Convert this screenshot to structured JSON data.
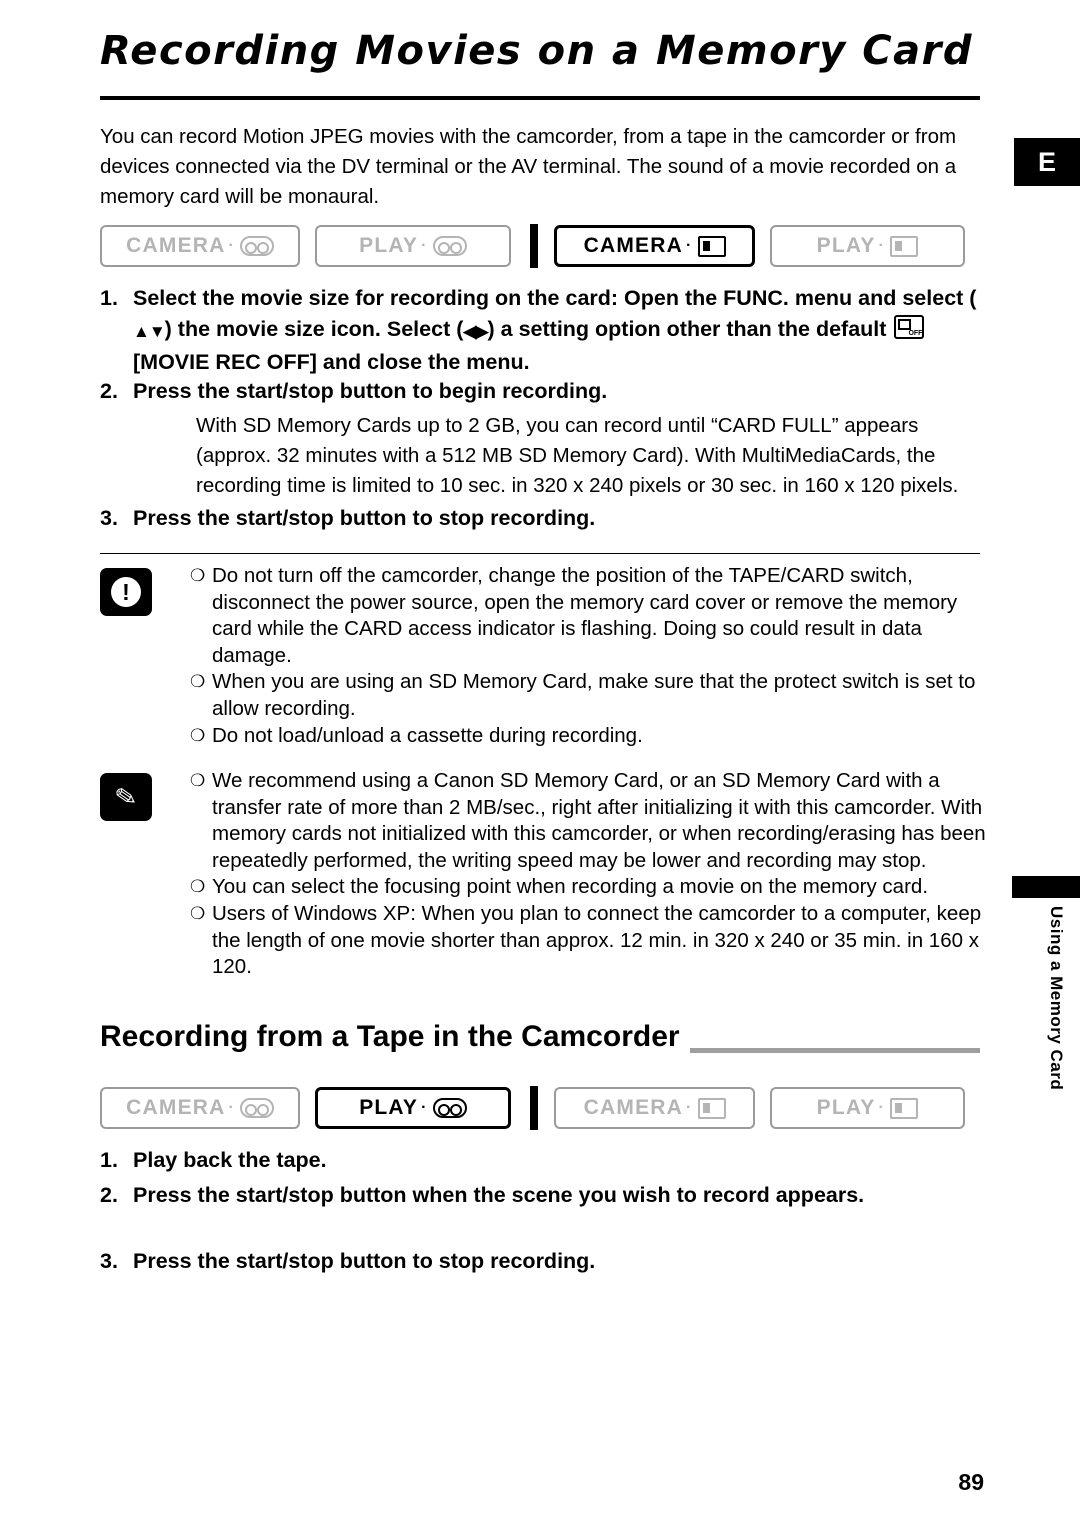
{
  "page": {
    "title": "Recording Movies on a Memory Card",
    "lang_tab": "E",
    "page_number": "89",
    "side_tab": "Using a Memory Card"
  },
  "intro": "You can record Motion JPEG movies with the camcorder, from a tape in the camcorder or from devices connected via the DV terminal or the AV terminal. The sound of a movie recorded on a memory card will be monaural.",
  "modes_row1": [
    {
      "label": "CAMERA",
      "icon": "tape-icon",
      "active": false
    },
    {
      "label": "PLAY",
      "icon": "tape-icon",
      "active": false
    },
    {
      "label": "CAMERA",
      "icon": "card-icon",
      "active": true
    },
    {
      "label": "PLAY",
      "icon": "card-icon",
      "active": false
    }
  ],
  "modes_row2": [
    {
      "label": "CAMERA",
      "icon": "tape-icon",
      "active": false
    },
    {
      "label": "PLAY",
      "icon": "tape-icon",
      "active": true
    },
    {
      "label": "CAMERA",
      "icon": "card-icon",
      "active": false
    },
    {
      "label": "PLAY",
      "icon": "card-icon",
      "active": false
    }
  ],
  "steps": {
    "s1_num": "1.",
    "s1_a": "Select the movie size for recording on the card: Open the FUNC. menu and select (",
    "s1_b": ") the movie size icon. Select (",
    "s1_c": ") a setting option other than the default",
    "s1_d": "[MOVIE REC OFF] and close the menu.",
    "s2_num": "2.",
    "s2_text": "Press the start/stop button to begin recording.",
    "s2_body": "With SD Memory Cards up to 2 GB, you can record until “CARD FULL” appears (approx. 32 minutes with a 512 MB SD Memory Card). With MultiMediaCards, the recording time is limited to 10 sec. in 320 x 240 pixels or 30 sec. in 160 x 120 pixels.",
    "s3_num": "3.",
    "s3_text": "Press the start/stop button to stop recording."
  },
  "caution_notes": [
    "Do not turn off the camcorder, change the position of the TAPE/CARD switch, disconnect the power source, open the memory card cover or remove the memory card while the CARD access indicator is flashing. Doing so could result in data damage.",
    "When you are using an SD Memory Card, make sure that the protect switch is set to allow recording.",
    "Do not load/unload a cassette during recording."
  ],
  "info_notes": [
    "We recommend using a Canon SD Memory Card, or an SD Memory Card with a transfer rate of more than 2 MB/sec., right after initializing it with this camcorder. With memory cards not initialized with this camcorder, or when recording/erasing has been repeatedly performed, the writing speed may be lower and recording may stop.",
    "You can select the focusing point when recording a movie on the memory card.",
    "Users of Windows XP: When you plan to connect the camcorder to a computer, keep the length of one movie shorter than approx. 12 min. in 320 x 240 or 35 min. in 160 x 120."
  ],
  "subsection": {
    "heading": "Recording from a Tape in the Camcorder",
    "steps": [
      {
        "num": "1.",
        "text": "Play back the tape."
      },
      {
        "num": "2.",
        "text": "Press the start/stop button when the scene you wish to record appears."
      },
      {
        "num": "3.",
        "text": "Press the start/stop button to stop recording."
      }
    ]
  },
  "bullet_glyph": "❍"
}
